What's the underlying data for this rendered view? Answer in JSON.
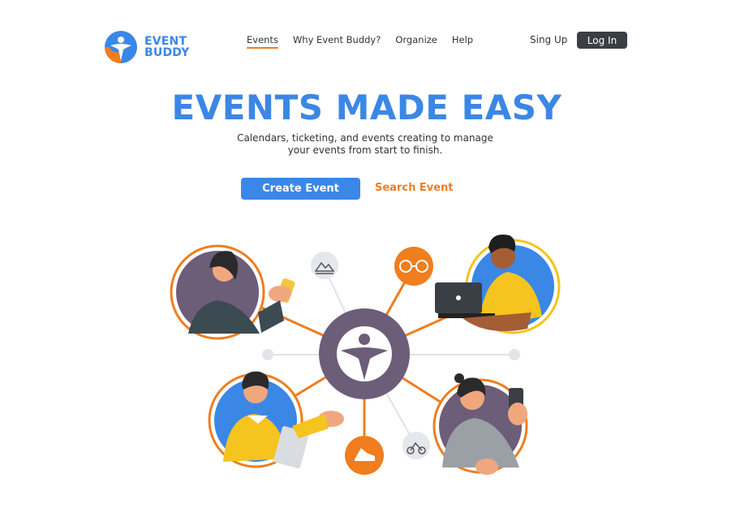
{
  "brand": {
    "line1": "EVENT",
    "line2": "BUDDY",
    "primary": "#3b87e6",
    "accent": "#f07d1e"
  },
  "nav": {
    "items": [
      "Events",
      "Why Event Buddy?",
      "Organize",
      "Help"
    ],
    "active": "Events"
  },
  "auth": {
    "signup_label": "Sing Up",
    "login_label": "Log In"
  },
  "hero": {
    "title": "EVENTS MADE EASY",
    "subtitle_line1": "Calendars, ticketing, and events creating to manage",
    "subtitle_line2": "your events from start to finish.",
    "create_label": "Create Event",
    "search_label": "Search Event"
  },
  "illustration": {
    "hub_icon": "event-buddy-logo-icon",
    "people": [
      "woman-with-phone",
      "man-with-laptop",
      "man-with-tablet",
      "woman-with-phone-glasses"
    ],
    "icons": [
      "landscape-icon",
      "film-reel-icon",
      "running-shoe-icon",
      "motorbike-icon"
    ]
  }
}
